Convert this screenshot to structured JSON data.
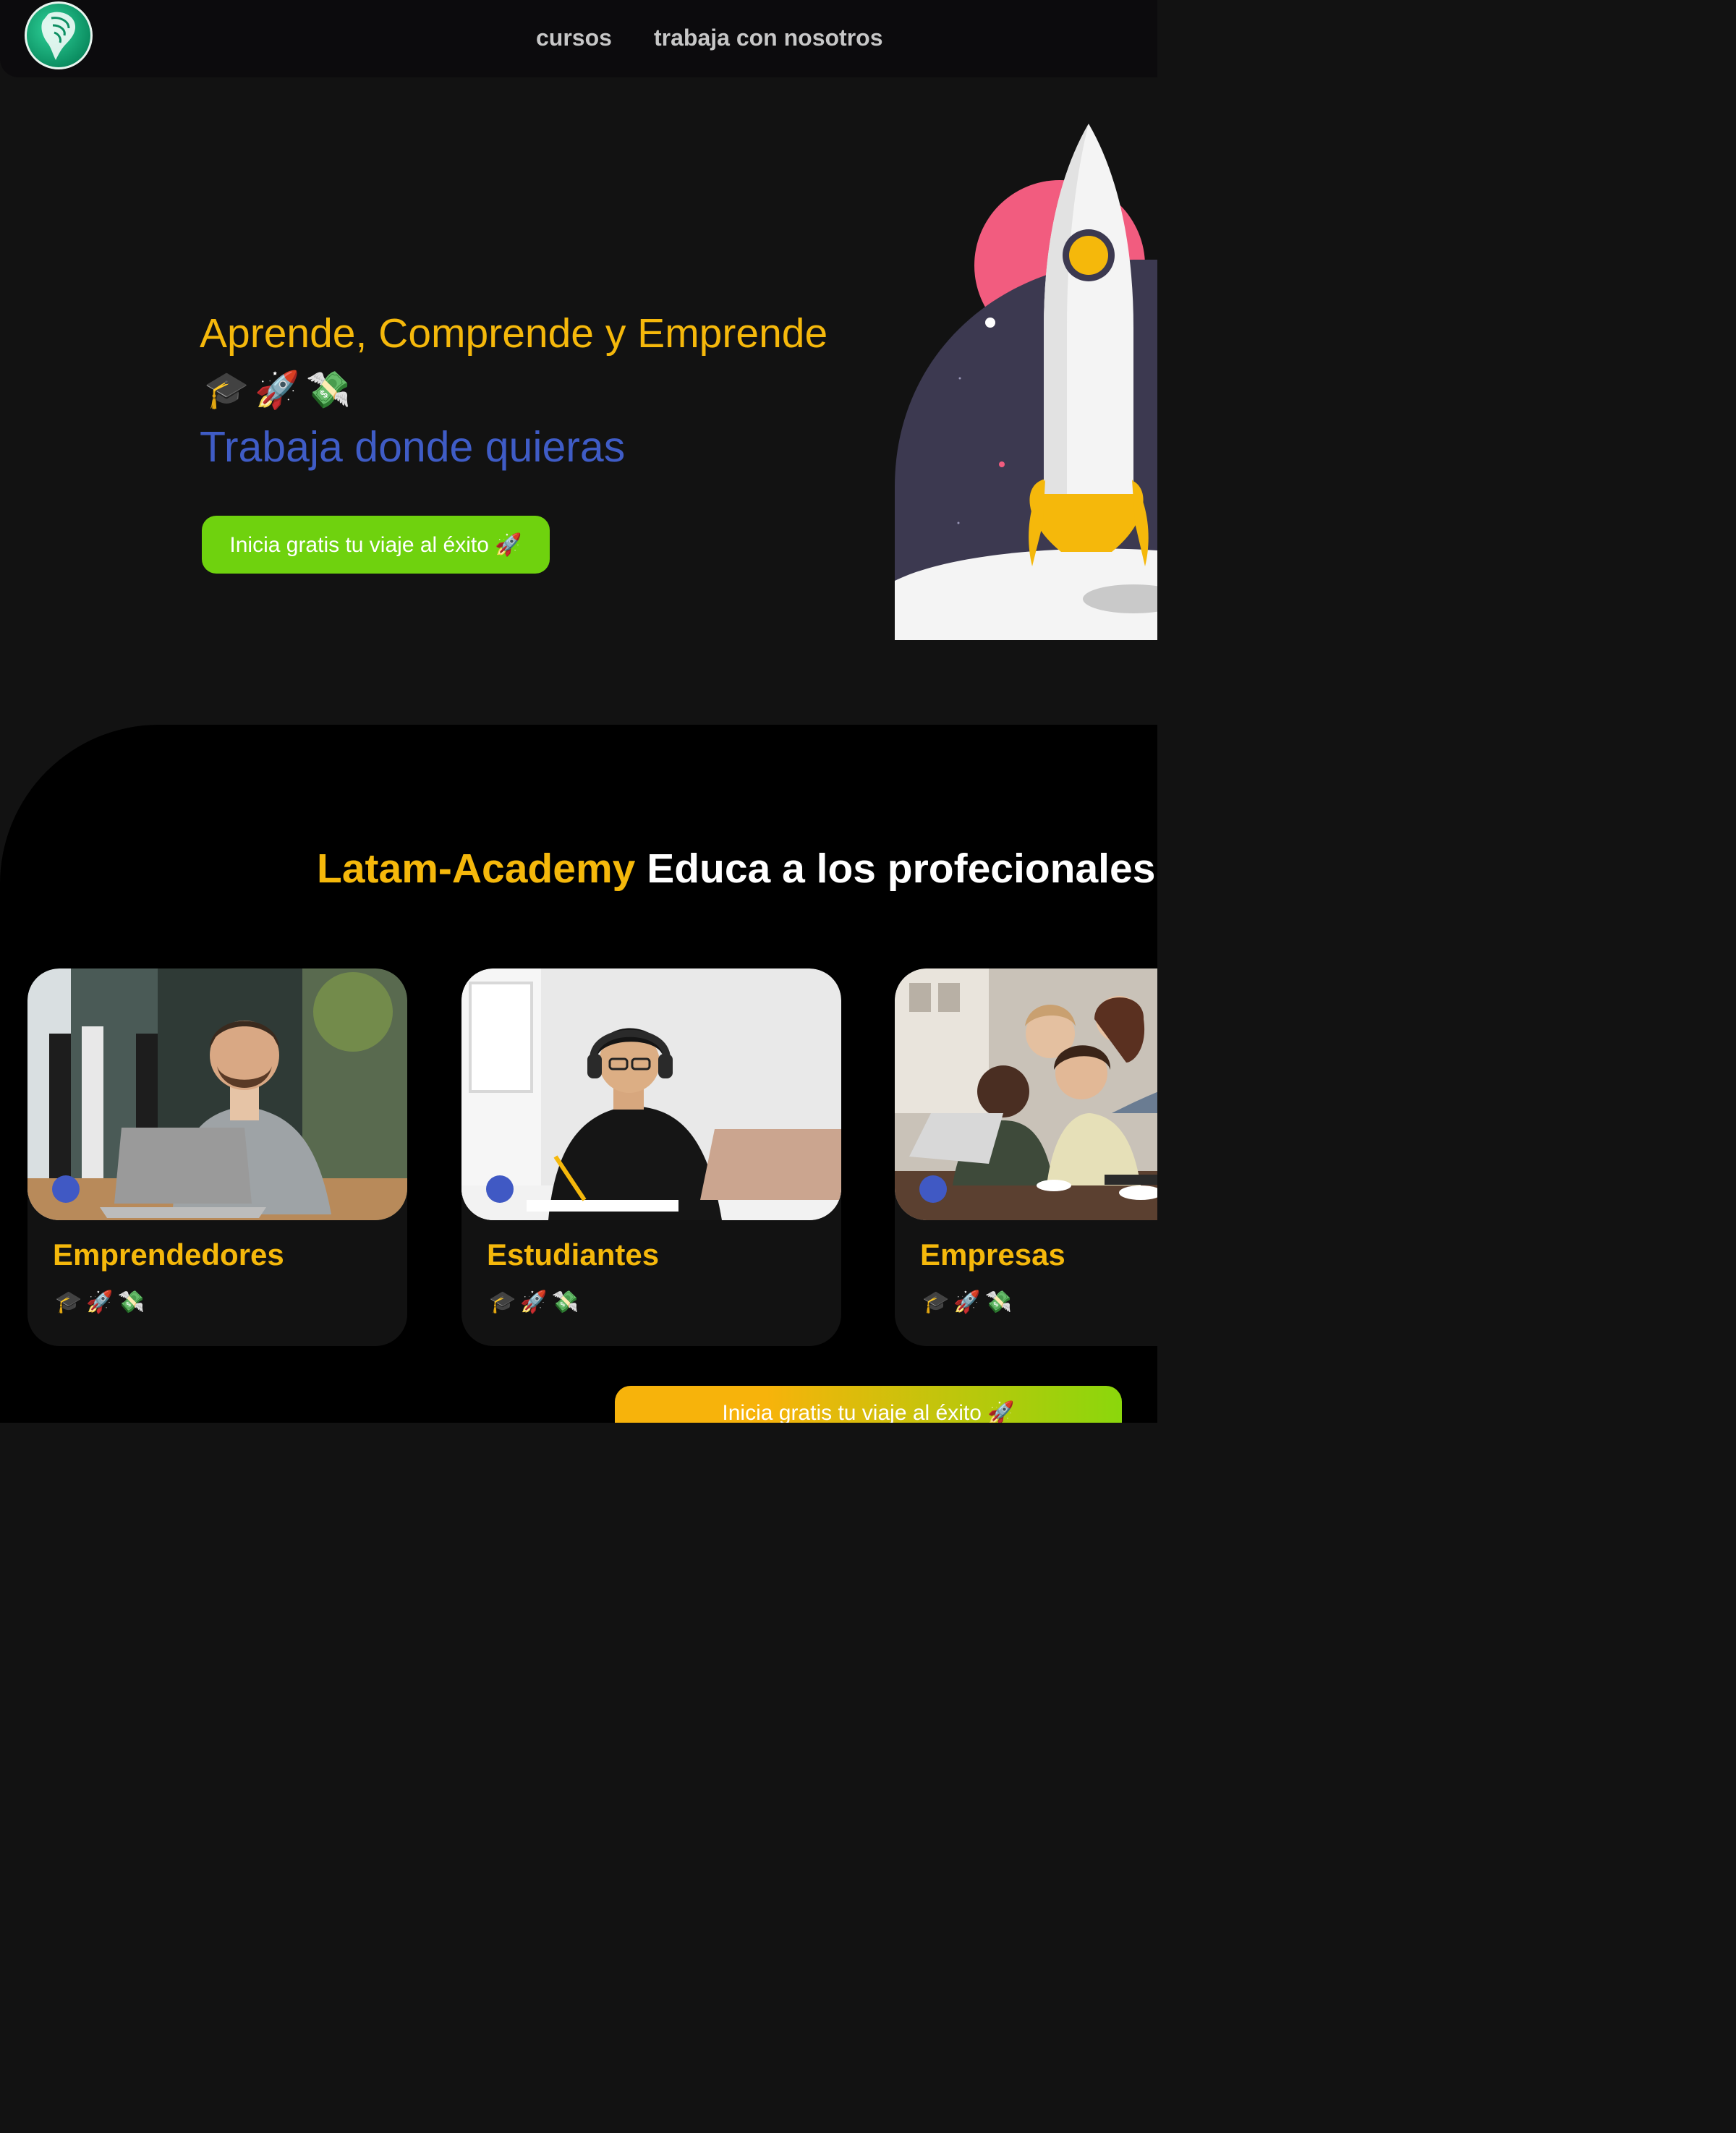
{
  "nav": {
    "logo_alt": "Latam-Academy logo",
    "links": [
      {
        "label": "cursos"
      },
      {
        "label": "trabaja con nosotros"
      }
    ]
  },
  "hero": {
    "title": "Aprende, Comprende y Emprende",
    "emojis": "🎓🚀💸",
    "subtitle": "Trabaja donde quieras",
    "cta_label": "Inicia gratis tu viaje al éxito 🚀"
  },
  "section": {
    "title_brand": "Latam-Academy",
    "title_rest": "Educa a los profecionales del",
    "cards": [
      {
        "title": "Emprendedores",
        "emojis": "🎓🚀💸"
      },
      {
        "title": "Estudiantes",
        "emojis": "🎓🚀💸"
      },
      {
        "title": "Empresas",
        "emojis": "🎓🚀💸"
      }
    ],
    "cta_label": "Inicia gratis tu viaje al éxito 🚀"
  },
  "colors": {
    "accent_yellow": "#f5b80b",
    "accent_blue": "#3f5cc6",
    "accent_green": "#6fd20e",
    "background": "#121212"
  }
}
